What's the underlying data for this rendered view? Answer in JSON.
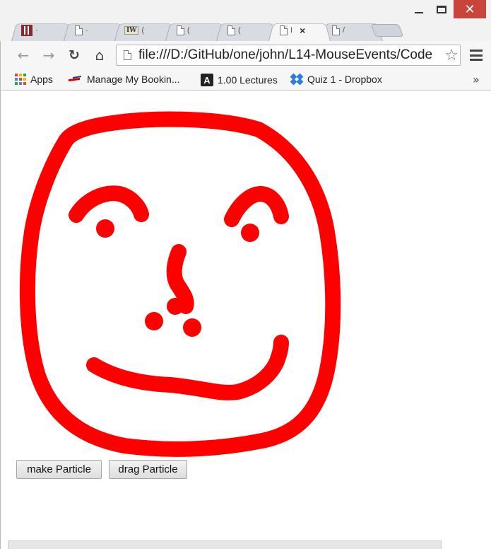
{
  "window": {
    "close_glyph": "✕"
  },
  "tabs": [
    {
      "label": "·",
      "active": false
    },
    {
      "label": "·",
      "active": false
    },
    {
      "label": "(",
      "active": false
    },
    {
      "label": "(",
      "active": false
    },
    {
      "label": "(",
      "active": false
    },
    {
      "label": "I",
      "active": true
    },
    {
      "label": "/",
      "active": false
    }
  ],
  "toolbar": {
    "url": "file:///D:/GitHub/one/john/L14-MouseEvents/Code"
  },
  "bookmarks": [
    {
      "label": "Apps",
      "icon": "apps-grid-icon"
    },
    {
      "label": "Manage My Bookin...",
      "icon": "airline-icon"
    },
    {
      "label": "1.00 Lectures",
      "icon": "a-letter-icon"
    },
    {
      "label": "Quiz 1 - Dropbox",
      "icon": "dropbox-icon"
    }
  ],
  "bookmarks_more": "»",
  "page": {
    "buttons": {
      "make_particle": "make Particle",
      "drag_particle": "drag Particle"
    },
    "drawing": {
      "stroke_color": "#ff0000",
      "background": "#ffffff"
    }
  }
}
